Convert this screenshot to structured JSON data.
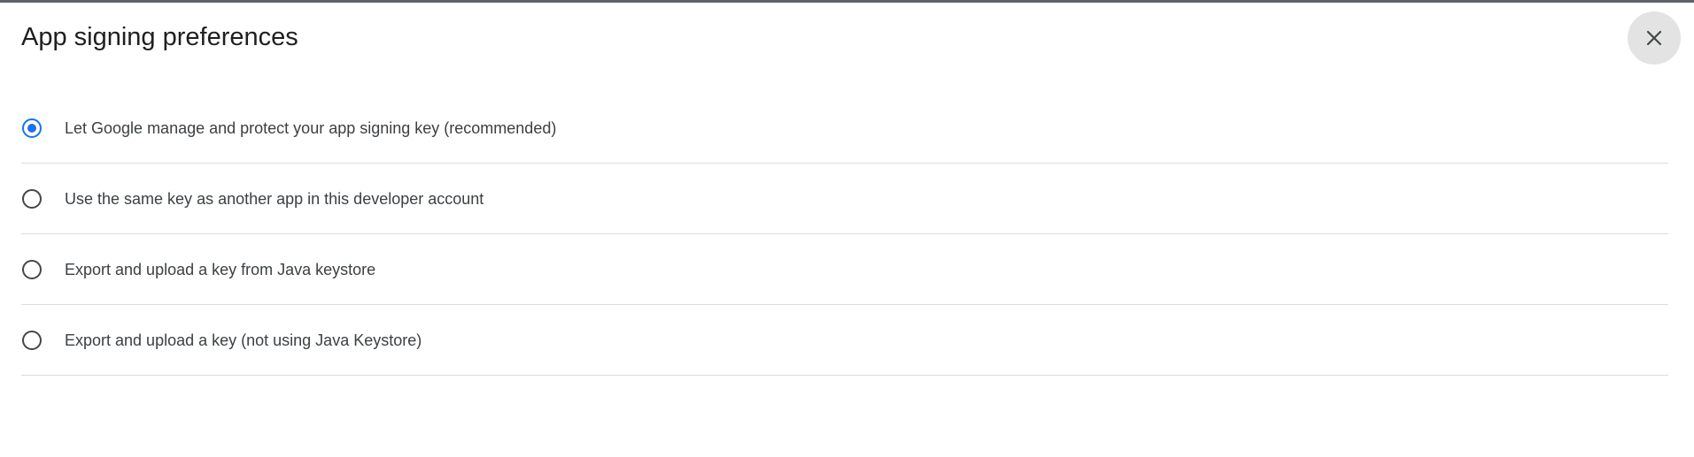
{
  "dialog": {
    "title": "App signing preferences",
    "close_icon": "close-icon"
  },
  "options": [
    {
      "label": "Let Google manage and protect your app signing key (recommended)",
      "selected": true
    },
    {
      "label": "Use the same key as another app in this developer account",
      "selected": false
    },
    {
      "label": "Export and upload a key from Java keystore",
      "selected": false
    },
    {
      "label": "Export and upload a key (not using Java Keystore)",
      "selected": false
    }
  ],
  "colors": {
    "accent": "#1a73e8",
    "divider": "#dadce0",
    "close_button_bg": "#e3e3e3"
  }
}
